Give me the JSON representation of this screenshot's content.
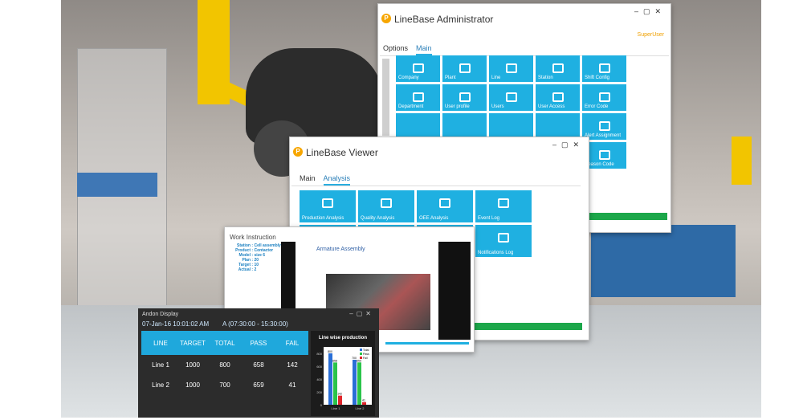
{
  "admin": {
    "title": "LineBase Administrator",
    "user": "SuperUser",
    "tabs": [
      {
        "label": "Options",
        "active": false
      },
      {
        "label": "Main",
        "active": true
      }
    ],
    "tiles": [
      "Company",
      "Plant",
      "Line",
      "Station",
      "Shift Config",
      "Department",
      "User profile",
      "Users",
      "User Access",
      "Error Code",
      "",
      "",
      "",
      "",
      "Alert Assignment",
      "",
      "",
      "",
      "",
      "Reason Code"
    ],
    "tile_icons": [
      "building-icon",
      "map-pin-icon",
      "hierarchy-icon",
      "robot-arm-icon",
      "calendar-icon",
      "settings-grid-icon",
      "user-card-icon",
      "user-icon",
      "touch-icon",
      "chat-icon",
      "",
      "",
      "",
      "",
      "alert-icon",
      "",
      "",
      "",
      "",
      "reason-icon"
    ]
  },
  "viewer": {
    "title": "LineBase Viewer",
    "tabs": [
      {
        "label": "Main",
        "active": false
      },
      {
        "label": "Analysis",
        "active": true
      }
    ],
    "tiles": [
      "Production Analysis",
      "Quality Analysis",
      "OEE Analysis",
      "Event Log",
      "",
      "",
      "",
      "Notifications Log"
    ],
    "tile_icons": [
      "report-icon",
      "quality-icon",
      "oee-icon",
      "event-log-icon",
      "",
      "",
      "",
      "notifications-icon"
    ]
  },
  "work_instruction": {
    "title": "Work Instruction",
    "fields": [
      {
        "k": "Station",
        "v": "Cell assembly"
      },
      {
        "k": "Product",
        "v": "Contactor"
      },
      {
        "k": "Model",
        "v": "size 6"
      },
      {
        "k": "Plan",
        "v": "20"
      },
      {
        "k": "Target",
        "v": "10"
      },
      {
        "k": "Actual",
        "v": "2"
      }
    ],
    "slide_title": "Armature Assembly"
  },
  "andon": {
    "title": "Andon Display",
    "datetime": "07-Jan-16 10:01:02 AM",
    "shift": "A (07:30:00 - 15:30:00)",
    "headers": [
      "LINE",
      "TARGET",
      "TOTAL",
      "PASS",
      "FAIL"
    ],
    "rows": [
      [
        "Line 1",
        "1000",
        "800",
        "658",
        "142"
      ],
      [
        "Line 2",
        "1000",
        "700",
        "659",
        "41"
      ]
    ]
  },
  "chart_data": {
    "type": "bar",
    "title": "Line wise production",
    "categories": [
      "Line 1",
      "Line 2"
    ],
    "series": [
      {
        "name": "Total",
        "values": [
          800,
          700
        ],
        "color": "#2a6fd6"
      },
      {
        "name": "Pass",
        "values": [
          658,
          659
        ],
        "color": "#2bc44a"
      },
      {
        "name": "Fail",
        "values": [
          142,
          41
        ],
        "color": "#e0262b"
      }
    ],
    "y_ticks": [
      "800",
      "600",
      "400",
      "200",
      "0"
    ],
    "data_labels": [
      [
        "800",
        "658",
        "142"
      ],
      [
        "700",
        "659",
        "41"
      ]
    ],
    "ylim": [
      0,
      900
    ],
    "legend": "top-right"
  }
}
